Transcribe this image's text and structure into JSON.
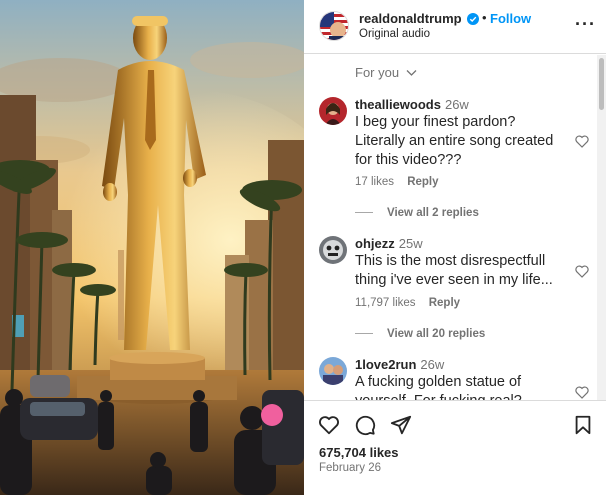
{
  "header": {
    "username": "realdonaldtrump",
    "follow_label": "Follow",
    "audio": "Original audio",
    "separator": "•",
    "more": "···"
  },
  "sort": {
    "label": "For you"
  },
  "comments": [
    {
      "username": "thealliewoods",
      "time": "26w",
      "text": "I beg your finest pardon? Literally an entire song created for this video???",
      "likes": "17 likes",
      "reply": "Reply",
      "view_replies": "View all 2 replies"
    },
    {
      "username": "ohjezz",
      "time": "25w",
      "text": "This is the most disrespectfull thing i've ever seen in my life...",
      "likes": "11,797 likes",
      "reply": "Reply",
      "view_replies": "View all 20 replies"
    },
    {
      "username": "1love2run",
      "time": "26w",
      "text": "A fucking golden statue of yourself. For fucking real?",
      "likes": "",
      "reply": "",
      "view_replies": ""
    }
  ],
  "footer": {
    "likes": "675,704 likes",
    "date": "February 26"
  },
  "colors": {
    "accent": "#0095f6",
    "text": "#262626",
    "muted": "#737373",
    "gold": "#d9a43a"
  }
}
